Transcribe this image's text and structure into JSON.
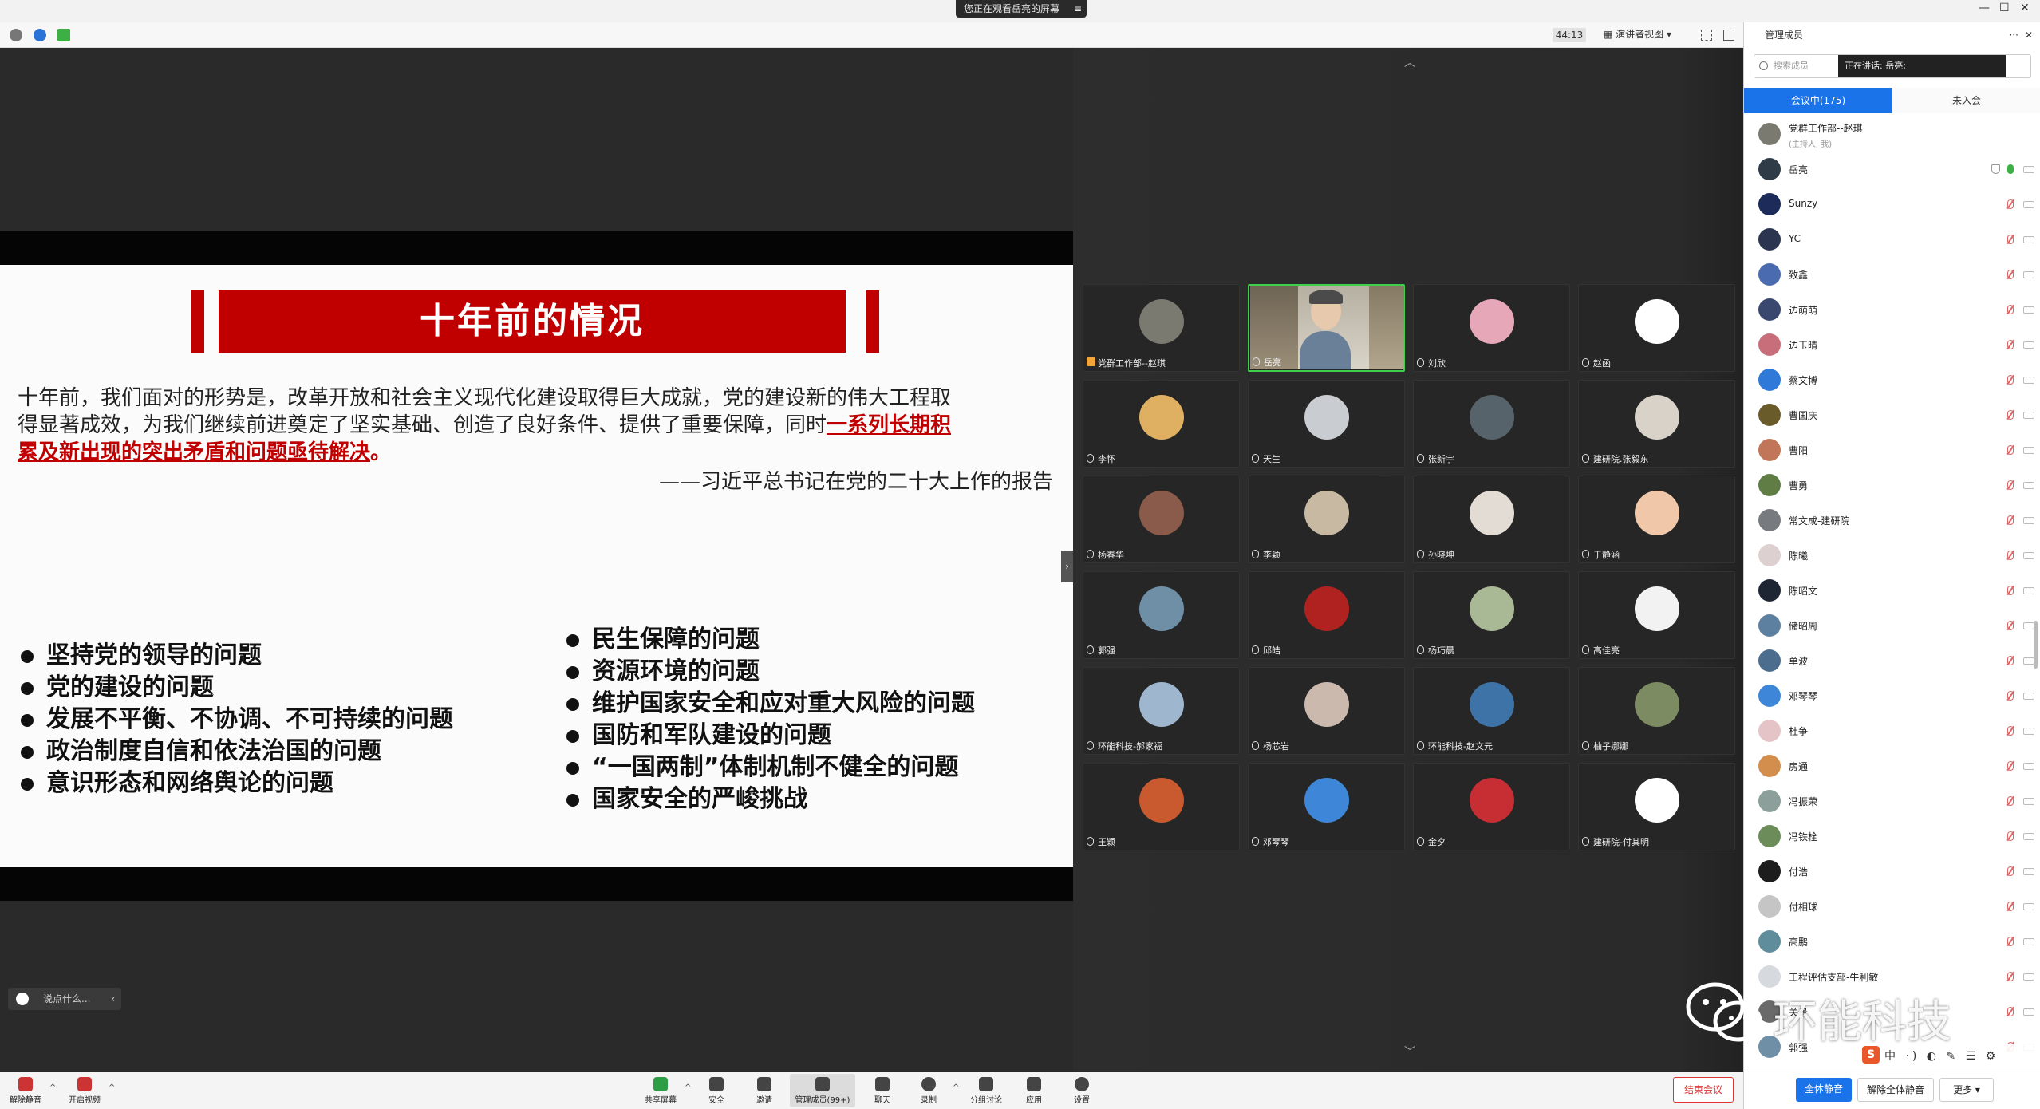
{
  "window": {
    "banner": "您正在观看岳亮的屏幕",
    "menu_icon": "≡",
    "minimize": "—",
    "maximize": "☐",
    "close": "✕"
  },
  "toolbar": {
    "timer": "44:13",
    "view_label": "演讲者视图"
  },
  "slide": {
    "title": "十年前的情况",
    "para_lines": [
      "十年前，我们面对的形势是，改革开放和社会主义现代化建设取得巨大成就，党的建设新的伟大工程取",
      "得显著成效，为我们继续前进奠定了坚实基础、创造了良好条件、提供了重要保障，同时"
    ],
    "para_red_1": "一系列长期积",
    "para_red_2": "累及新出现的突出矛盾和问题亟待解决",
    "para_end": "。",
    "quote": "——习近平总书记在党的二十大上作的报告",
    "left_bullets": [
      "坚持党的领导的问题",
      "党的建设的问题",
      "发展不平衡、不协调、不可持续的问题",
      "政治制度自信和依法治国的问题",
      "意识形态和网络舆论的问题"
    ],
    "right_bullets": [
      "民生保障的问题",
      "资源环境的问题",
      "维护国家安全和应对重大风险的问题",
      "国防和军队建设的问题",
      "“一国两制”体制机制不健全的问题",
      "国家安全的严峻挑战"
    ]
  },
  "chat": {
    "placeholder": "说点什么..."
  },
  "gallery": {
    "up_arrow": "︿",
    "down_arrow": "﹀",
    "tiles": [
      {
        "name": "党群工作部--赵琪",
        "color": "#7a7a70"
      },
      {
        "name": "岳亮",
        "color": "#ccc"
      },
      {
        "name": "刘欣",
        "color": "#e6a7b8"
      },
      {
        "name": "赵函",
        "color": "#ffffff"
      },
      {
        "name": "李怀",
        "color": "#e0b062"
      },
      {
        "name": "天生",
        "color": "#c9cdd2"
      },
      {
        "name": "张新宇",
        "color": "#56636a"
      },
      {
        "name": "建研院.张毅东",
        "color": "#d8d2c8"
      },
      {
        "name": "杨春华",
        "color": "#8a5a4a"
      },
      {
        "name": "李颖",
        "color": "#c8b9a3"
      },
      {
        "name": "孙晓坤",
        "color": "#e3dcd4"
      },
      {
        "name": "于静涵",
        "color": "#f0c7a8"
      },
      {
        "name": "郭强",
        "color": "#6e8fa6"
      },
      {
        "name": "邱皓",
        "color": "#b0221f"
      },
      {
        "name": "杨巧晨",
        "color": "#a9b895"
      },
      {
        "name": "高佳亮",
        "color": "#f2f2f2"
      },
      {
        "name": "环能科技-郝家福",
        "color": "#9fb6cf"
      },
      {
        "name": "杨芯岩",
        "color": "#cbb9ad"
      },
      {
        "name": "环能科技-赵文元",
        "color": "#3e73a8"
      },
      {
        "name": "柚子娜娜",
        "color": "#7d8b63"
      },
      {
        "name": "王颖",
        "color": "#c9592e"
      },
      {
        "name": "邓琴琴",
        "color": "#3d86d8"
      },
      {
        "name": "金夕",
        "color": "#c62e34"
      },
      {
        "name": "建研院-付其明",
        "color": "#ffffff"
      }
    ]
  },
  "panel": {
    "title": "管理成员",
    "dots": "···",
    "close": "✕",
    "search_placeholder": "搜索成员",
    "speaking": "正在讲话: 岳亮;",
    "tab_in": "会议中(175)",
    "tab_out": "未入会",
    "participants": [
      {
        "name": "党群工作部--赵琪",
        "sub": "(主持人, 我)",
        "color": "#7a7a70"
      },
      {
        "name": "岳亮",
        "sub": "",
        "color": "#2f3c48"
      },
      {
        "name": "Sunzy",
        "sub": "",
        "color": "#1c2b5a"
      },
      {
        "name": "YC",
        "sub": "",
        "color": "#2b3550"
      },
      {
        "name": "致鑫",
        "sub": "",
        "color": "#4a6bb0"
      },
      {
        "name": "边萌萌",
        "sub": "",
        "color": "#3a4870"
      },
      {
        "name": "边玉晴",
        "sub": "",
        "color": "#c86e7a"
      },
      {
        "name": "蔡文博",
        "sub": "",
        "color": "#2f7ad9"
      },
      {
        "name": "曹国庆",
        "sub": "",
        "color": "#6a5b2b"
      },
      {
        "name": "曹阳",
        "sub": "",
        "color": "#c27659"
      },
      {
        "name": "曹勇",
        "sub": "",
        "color": "#5f7d45"
      },
      {
        "name": "常文成-建研院",
        "sub": "",
        "color": "#777b80"
      },
      {
        "name": "陈曦",
        "sub": "",
        "color": "#ddd0d0"
      },
      {
        "name": "陈昭文",
        "sub": "",
        "color": "#1f2633"
      },
      {
        "name": "储昭周",
        "sub": "",
        "color": "#5d7fa0"
      },
      {
        "name": "单波",
        "sub": "",
        "color": "#4d6d8e"
      },
      {
        "name": "邓琴琴",
        "sub": "",
        "color": "#3d86d8"
      },
      {
        "name": "杜争",
        "sub": "",
        "color": "#e5c4c8"
      },
      {
        "name": "房通",
        "sub": "",
        "color": "#d38d4d"
      },
      {
        "name": "冯振荣",
        "sub": "",
        "color": "#8d9f9b"
      },
      {
        "name": "冯铁栓",
        "sub": "",
        "color": "#6c8c5a"
      },
      {
        "name": "付浩",
        "sub": "",
        "color": "#1d1d1d"
      },
      {
        "name": "付相球",
        "sub": "",
        "color": "#c5c5c5"
      },
      {
        "name": "高鹏",
        "sub": "",
        "color": "#5f8d9c"
      },
      {
        "name": "工程评估支部-牛利敏",
        "sub": "",
        "color": "#d6d9de"
      },
      {
        "name": "关景",
        "sub": "",
        "color": "#6a6a6a"
      },
      {
        "name": "郭强",
        "sub": "",
        "color": "#6e8fa6"
      }
    ],
    "btn_mute_all": "全体静音",
    "btn_unmute_all": "解除全体静音",
    "btn_more": "更多 ▾"
  },
  "ime": {
    "logo": "S",
    "text": "中 ·) ◐ ✎ ☰ ⚙"
  },
  "controls": {
    "unmute": "解除静音",
    "start_video": "开启视频",
    "share": "共享屏幕",
    "security": "安全",
    "invite": "邀请",
    "members": "管理成员(99+)",
    "chat": "聊天",
    "record": "录制",
    "breakout": "分组讨论",
    "apps": "应用",
    "settings": "设置",
    "end": "结束会议"
  },
  "watermark": {
    "text": "环能科技"
  }
}
